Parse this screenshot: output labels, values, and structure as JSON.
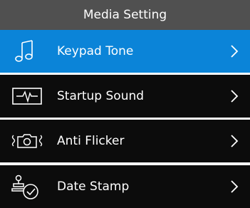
{
  "header": {
    "title": "Media Setting"
  },
  "colors": {
    "header_bg": "#505050",
    "selected_bg": "#0b84d8",
    "item_bg": "#0c0c0c",
    "separator": "#ffffff",
    "text": "#ffffff"
  },
  "menu": {
    "items": [
      {
        "label": "Keypad Tone",
        "icon": "music-note-icon",
        "selected": true
      },
      {
        "label": "Startup Sound",
        "icon": "waveform-icon",
        "selected": false
      },
      {
        "label": "Anti Flicker",
        "icon": "camera-flicker-icon",
        "selected": false
      },
      {
        "label": "Date Stamp",
        "icon": "date-stamp-icon",
        "selected": false
      }
    ]
  }
}
